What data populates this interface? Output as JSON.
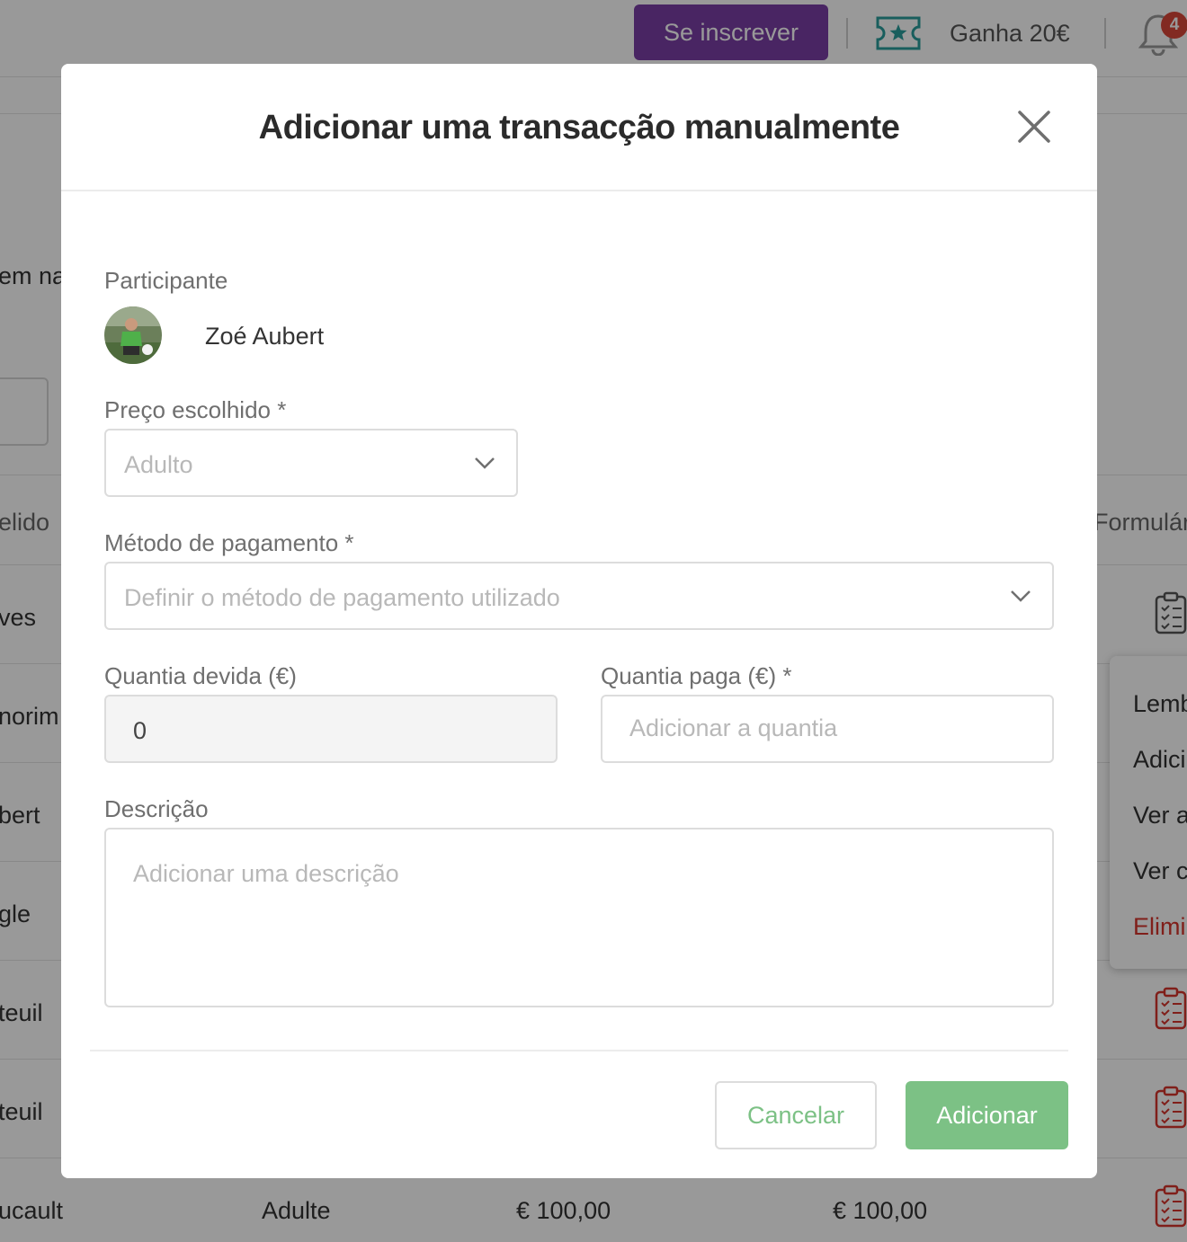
{
  "header": {
    "subscribe_label": "Se inscrever",
    "earn_label": "Ganha 20€",
    "notification_count": "4",
    "brand_color": "#7b3fa6"
  },
  "background": {
    "partial_texts": [
      "em na",
      "elido",
      "ves",
      "norim",
      "bert",
      "gle",
      "teuil",
      "teuil",
      "ucault"
    ],
    "column_header_right": "Formulár",
    "last_row": {
      "price": "Adulte",
      "owed": "€ 100,00",
      "paid": "€ 100,00"
    },
    "context_menu": [
      "Lemb",
      "Adici",
      "Ver a",
      "Ver c",
      "Elimi"
    ]
  },
  "modal": {
    "title": "Adicionar uma transacção manualmente",
    "participant_label": "Participante",
    "participant_name": "Zoé Aubert",
    "price_label": "Preço escolhido *",
    "price_value": "Adulto",
    "payment_label": "Método de pagamento *",
    "payment_placeholder": "Definir o método de pagamento utilizado",
    "owed_label": "Quantia devida (€)",
    "owed_value": "0",
    "paid_label": "Quantia paga (€) *",
    "paid_placeholder": "Adicionar a quantia",
    "description_label": "Descrição",
    "description_placeholder": "Adicionar uma descrição",
    "cancel_label": "Cancelar",
    "add_label": "Adicionar",
    "accent_color": "#7cc185"
  }
}
